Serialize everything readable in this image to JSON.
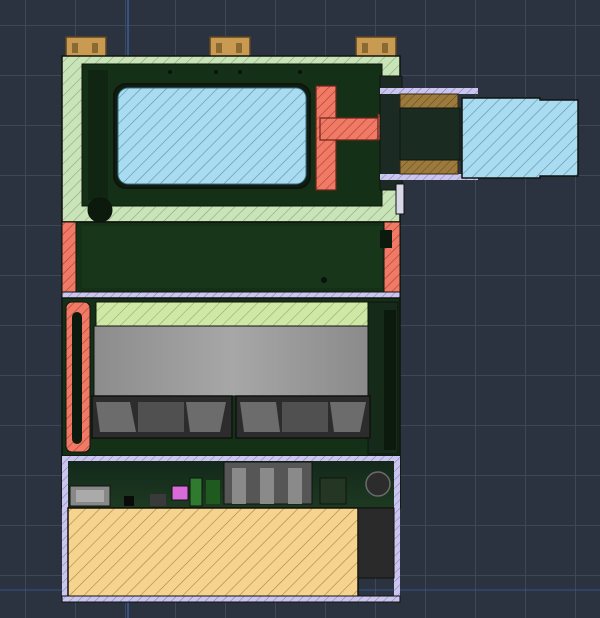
{
  "view": {
    "type": "section-view",
    "background": "#2c3340",
    "grid_color": "#3e4757",
    "axis_color": "#3d63b8"
  },
  "colors": {
    "body_dark": "#143016",
    "body_shadow": "#0c1a0d",
    "wall_green": "#c9e4b8",
    "plate_yellowgreen": "#cfe8a6",
    "heatsink_gray": "#9a9a9a",
    "copper_red": "#f07a66",
    "glass_blue": "#a9dcf0",
    "battery_yellow": "#f6d48f",
    "hinge_gold": "#c89a52",
    "holder_tan": "#9c7a3c",
    "lavender": "#cbc6ee",
    "edge": "#10130e"
  },
  "parts": {
    "hinges": [
      "hinge",
      "hinge",
      "hinge"
    ],
    "upper_enclosure": "enclosure-upper",
    "optics_window": "optical-window",
    "laser_barrel": "lens-barrel",
    "copper_mount": "copper-mount",
    "mid_chamber": "mid-chamber",
    "heatsink_plate": "heatsink-plate",
    "cooling_fans": [
      "fan-left",
      "fan-right"
    ],
    "electronics_bay": "electronics-bay",
    "battery_pack": "battery-pack"
  }
}
